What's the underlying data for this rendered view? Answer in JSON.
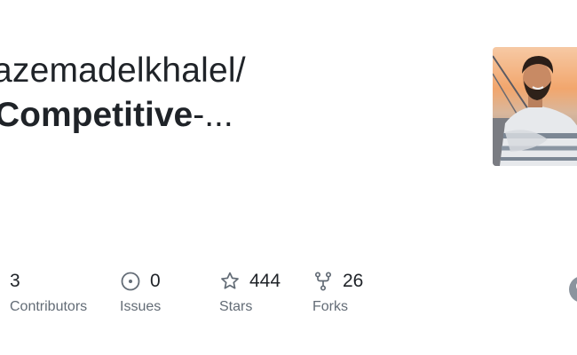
{
  "repo": {
    "owner_line": "azemadelkhalel/",
    "name": "Competitive",
    "name_suffix": "-..."
  },
  "stats": [
    {
      "icon": "people-icon",
      "value": "3",
      "label": "Contributors"
    },
    {
      "icon": "issue-circle-icon",
      "value": "0",
      "label": "Issues"
    },
    {
      "icon": "star-icon",
      "value": "444",
      "label": "Stars"
    },
    {
      "icon": "fork-icon",
      "value": "26",
      "label": "Forks"
    }
  ],
  "colors": {
    "text_primary": "#1f2328",
    "text_muted": "#636c76",
    "icon": "#636c76"
  }
}
